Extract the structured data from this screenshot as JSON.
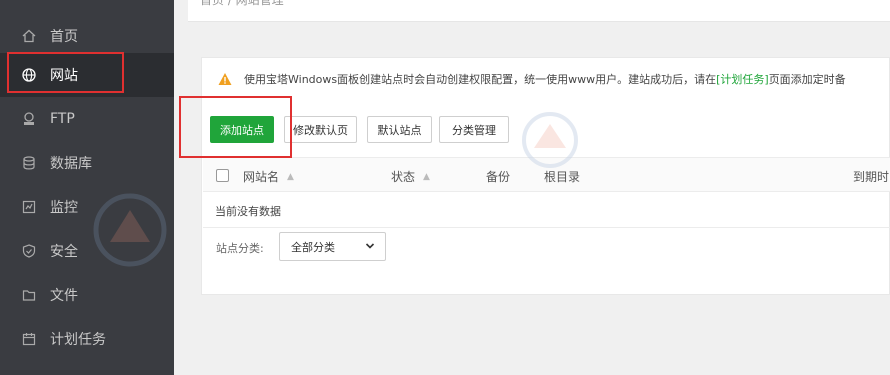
{
  "breadcrumb": {
    "text": "首页 / 网站管理"
  },
  "sidebar": {
    "items": [
      {
        "label": "首页",
        "icon": "home-icon"
      },
      {
        "label": "网站",
        "icon": "globe-icon"
      },
      {
        "label": "FTP",
        "icon": "ftp-icon"
      },
      {
        "label": "数据库",
        "icon": "database-icon"
      },
      {
        "label": "监控",
        "icon": "monitor-icon"
      },
      {
        "label": "安全",
        "icon": "shield-icon"
      },
      {
        "label": "文件",
        "icon": "folder-icon"
      },
      {
        "label": "计划任务",
        "icon": "calendar-icon"
      }
    ]
  },
  "notice": {
    "prefix": "使用宝塔Windows面板创建站点时会自动创建权限配置，统一使用www用户。建站成功后，请在",
    "link": "[计划任务]",
    "suffix": "页面添加定时备"
  },
  "toolbar": {
    "add_site": "添加站点",
    "edit_default_page": "修改默认页",
    "default_site": "默认站点",
    "category_manage": "分类管理"
  },
  "table": {
    "columns": [
      "网站名",
      "状态",
      "备份",
      "根目录",
      "到期时"
    ],
    "empty_text": "当前没有数据"
  },
  "filter": {
    "label": "站点分类:",
    "selected": "全部分类"
  },
  "colors": {
    "sidebar_bg": "#3a3c41",
    "accent_green": "#20a53a",
    "highlight_red": "#e03030"
  }
}
